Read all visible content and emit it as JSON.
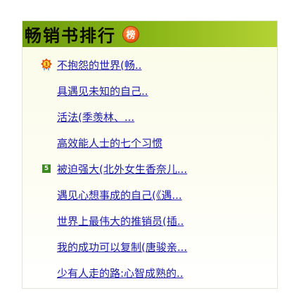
{
  "header": {
    "title": "畅销书排行",
    "badge": "榜"
  },
  "colors": {
    "header_gradient_start": "#6e9a0f",
    "header_gradient_end": "#b4d233",
    "link": "#1a1aa6",
    "badge": "#ef5b1c",
    "rank_square": "#3d8a1e"
  },
  "books": [
    {
      "rank_icon": "medal-icon",
      "rank": "1",
      "title": "不抱怨的世界(畅.."
    },
    {
      "rank_icon": "",
      "rank": "",
      "title": "具遇见未知的自己.."
    },
    {
      "rank_icon": "",
      "rank": "",
      "title": "活法(季羡林、..."
    },
    {
      "rank_icon": "",
      "rank": "",
      "title": "高效能人士的七个习惯"
    },
    {
      "rank_icon": "rank-square-icon",
      "rank": "5",
      "title": "被迫强大(北外女生香奈儿..."
    },
    {
      "rank_icon": "",
      "rank": "",
      "title": "遇见心想事成的自己(《遇..."
    },
    {
      "rank_icon": "",
      "rank": "",
      "title": "世界上最伟大的推销员(插.."
    },
    {
      "rank_icon": "",
      "rank": "",
      "title": "我的成功可以复制(唐骏亲..."
    },
    {
      "rank_icon": "",
      "rank": "",
      "title": "少有人走的路:心智成熟的.."
    }
  ]
}
